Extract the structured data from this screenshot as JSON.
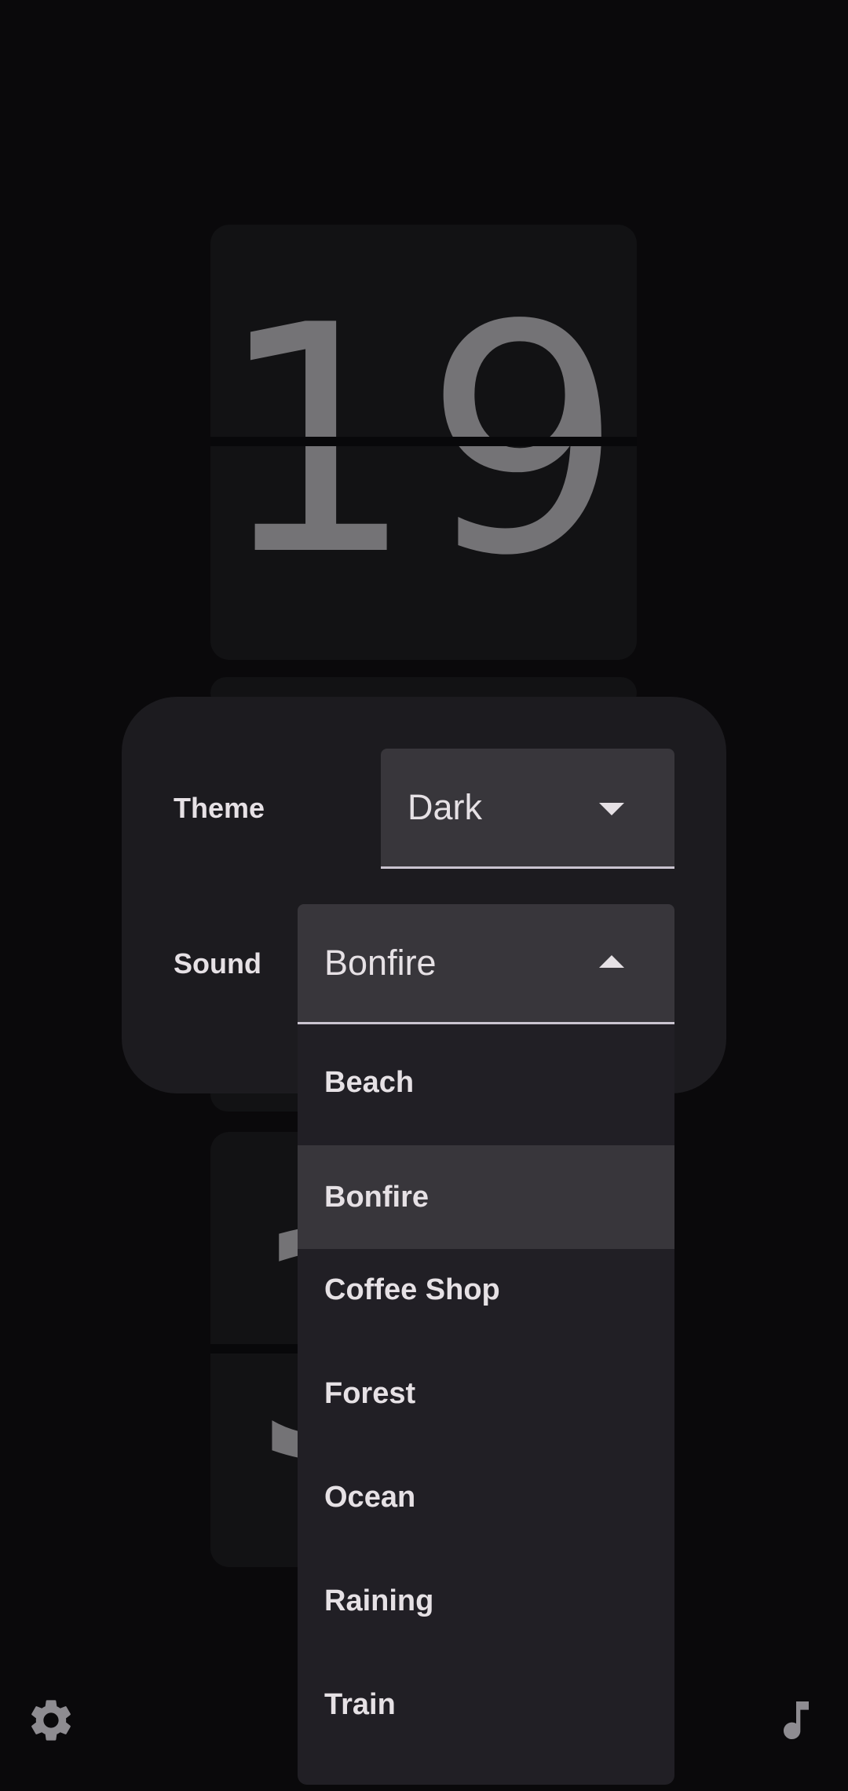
{
  "clock": {
    "hour": "19",
    "minute": "3"
  },
  "settings": {
    "theme_label": "Theme",
    "theme_value": "Dark",
    "sound_label": "Sound",
    "sound_value": "Bonfire"
  },
  "sound_menu": {
    "items": [
      "Beach",
      "Bonfire",
      "Coffee Shop",
      "Forest",
      "Ocean",
      "Raining",
      "Train"
    ],
    "selected": "Bonfire"
  },
  "icons": {
    "settings": "gear-icon",
    "music": "music-note-icon"
  },
  "colors": {
    "background": "#0a090b",
    "panel": "#1c1b1f",
    "field": "#38363b",
    "menu": "#211f25",
    "text": "#e6e1e5",
    "digit": "#747376",
    "icon": "#8e8c91"
  }
}
